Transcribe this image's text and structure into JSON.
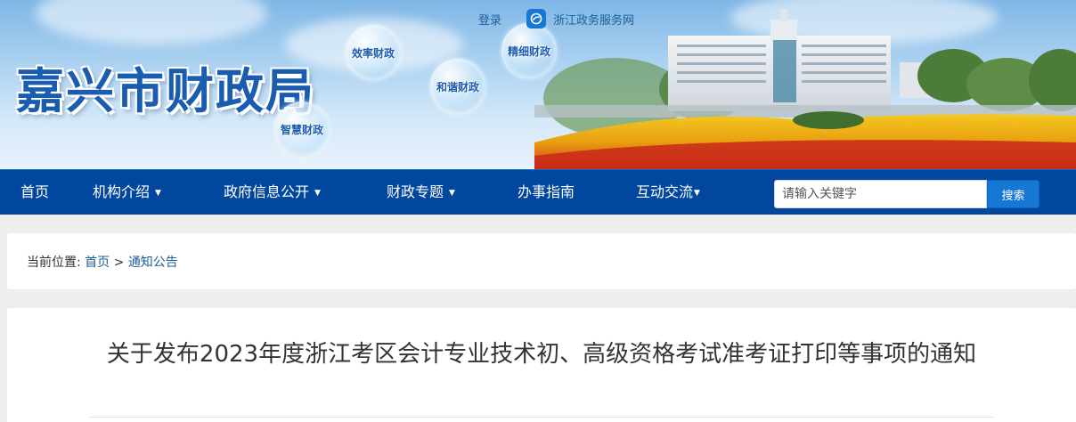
{
  "header": {
    "site_title": "嘉兴市财政局",
    "login": "登录",
    "portal_link": "浙江政务服务网",
    "slogans": [
      "效率财政",
      "精细财政",
      "和谐财政",
      "智慧财政"
    ]
  },
  "nav": {
    "items": [
      {
        "label": "首页",
        "has_dropdown": false
      },
      {
        "label": "机构介绍",
        "has_dropdown": true
      },
      {
        "label": "政府信息公开",
        "has_dropdown": true
      },
      {
        "label": "财政专题",
        "has_dropdown": true
      },
      {
        "label": "办事指南",
        "has_dropdown": false
      },
      {
        "label": "互动交流",
        "has_dropdown": true
      }
    ],
    "search_placeholder": "请输入关键字",
    "search_button": "搜索"
  },
  "breadcrumb": {
    "prefix": "当前位置:",
    "home": "首页",
    "separator": ">",
    "current": "通知公告"
  },
  "article": {
    "title": "关于发布2023年度浙江考区会计专业技术初、高级资格考试准考证打印等事项的通知"
  },
  "colors": {
    "nav_bg": "#00479d",
    "accent": "#1777d4",
    "title_blue": "#1a5cb0"
  }
}
